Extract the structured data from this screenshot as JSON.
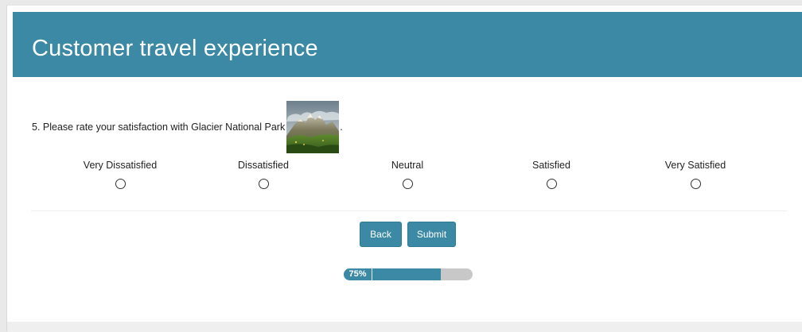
{
  "header": {
    "title": "Customer travel experience"
  },
  "question": {
    "text": "5. Please rate your satisfaction with Glacier National Park",
    "suffix": ".",
    "image_icon": "mountain-landscape-photo"
  },
  "scale": {
    "options": [
      {
        "label": "Very Dissatisfied",
        "selected": false
      },
      {
        "label": "Dissatisfied",
        "selected": false
      },
      {
        "label": "Neutral",
        "selected": false
      },
      {
        "label": "Satisfied",
        "selected": false
      },
      {
        "label": "Very Satisfied",
        "selected": false
      }
    ]
  },
  "buttons": {
    "back_label": "Back",
    "submit_label": "Submit"
  },
  "progress": {
    "label": "75%",
    "value": 0.75
  },
  "colors": {
    "accent": "#3b89a5",
    "progress_track": "#c8c8c8"
  }
}
